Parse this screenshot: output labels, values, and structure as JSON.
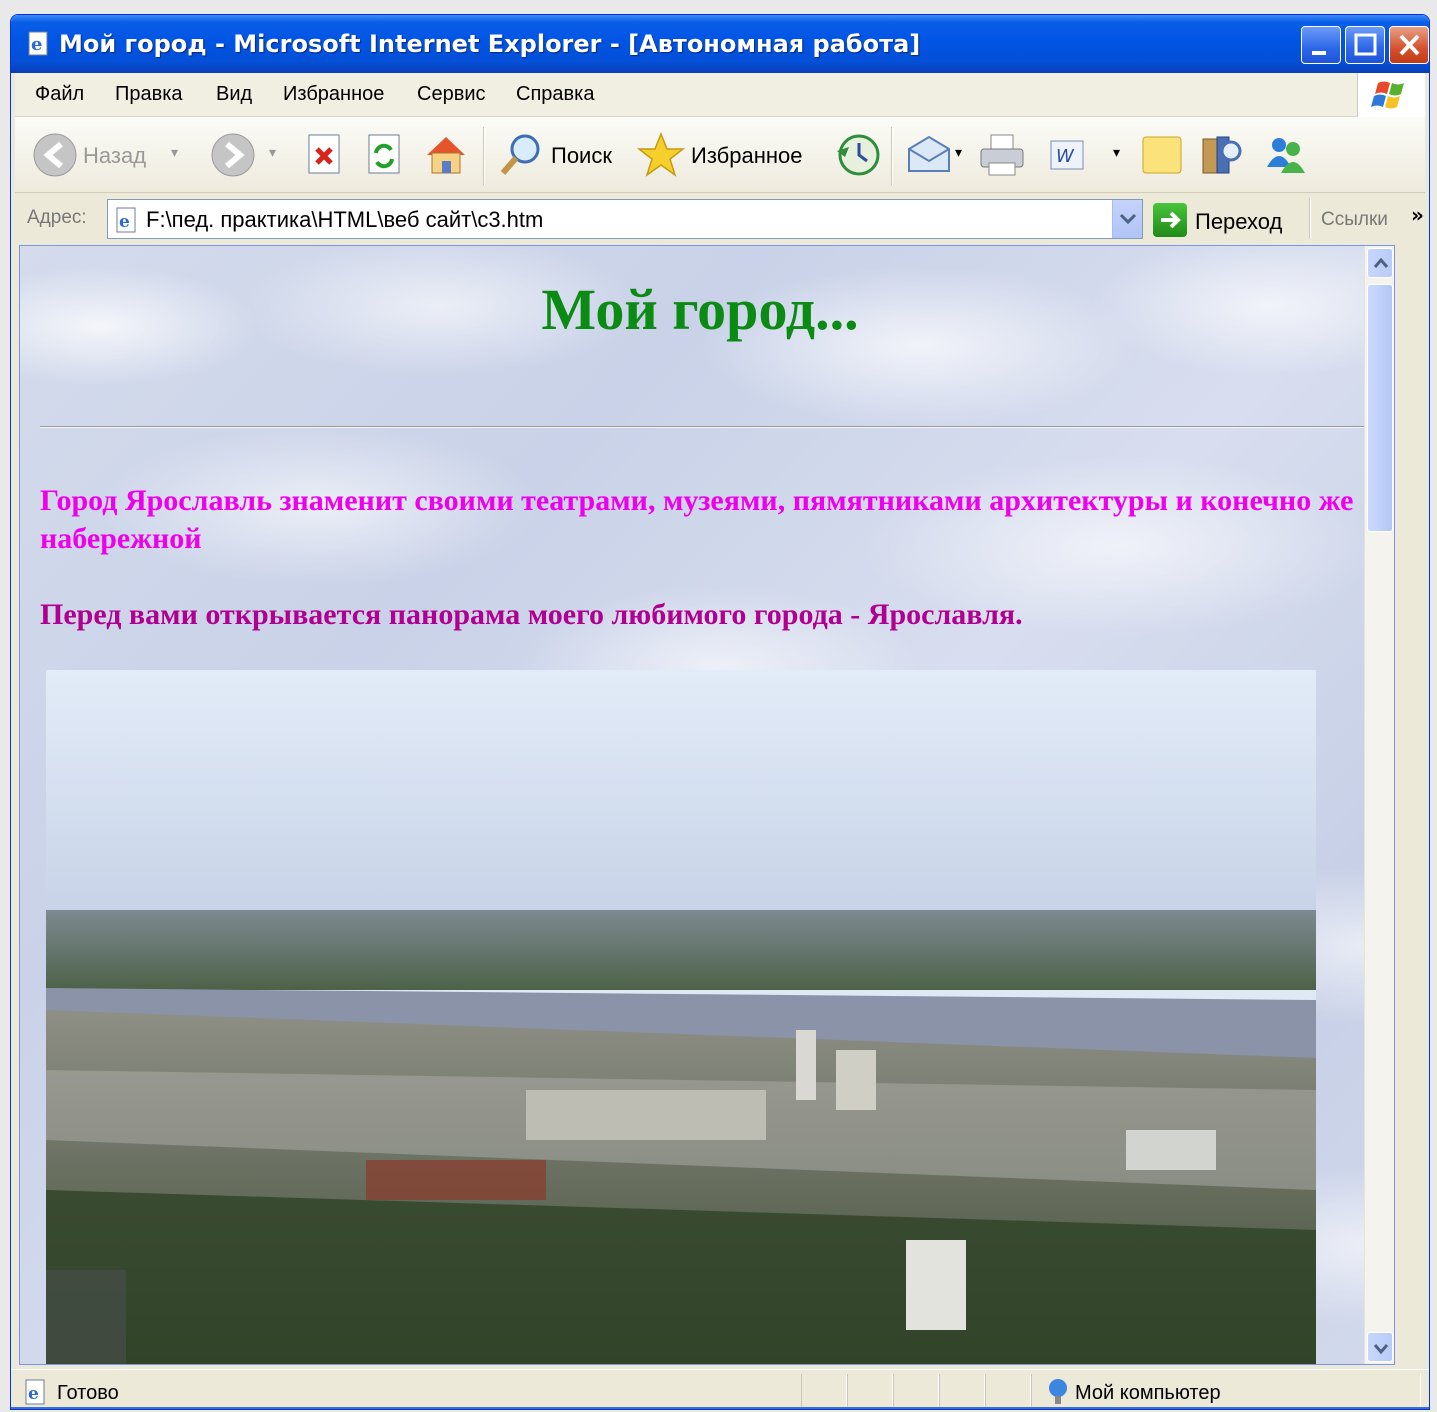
{
  "window": {
    "title": "Мой город - Microsoft Internet Explorer - [Автономная работа]"
  },
  "menu": {
    "items": [
      "Файл",
      "Правка",
      "Вид",
      "Избранное",
      "Сервис",
      "Справка"
    ]
  },
  "toolbar": {
    "back_label": "Назад",
    "search_label": "Поиск",
    "favorites_label": "Избранное"
  },
  "address": {
    "label": "Адрес:",
    "url": "F:\\пед. практика\\HTML\\веб сайт\\c3.htm",
    "go_label": "Переход",
    "links_label": "Ссылки",
    "links_chevron": "»"
  },
  "page": {
    "heading": "Мой город...",
    "paragraph1": "Город Ярославль знаменит своими театрами, музеями, пямятниками архитектуры и конечно же набережной",
    "paragraph2": "Перед вами открывается панорама моего любимого города - Ярославля.",
    "heading_color": "#0b8a14",
    "paragraph1_color": "#ee00ee",
    "paragraph2_color": "#b00090"
  },
  "status": {
    "text": "Готово",
    "zone": "Мой компьютер"
  },
  "icons": [
    "ie-page-icon",
    "back-arrow-icon",
    "forward-arrow-icon",
    "stop-icon",
    "refresh-icon",
    "home-icon",
    "search-magnifier-icon",
    "favorites-star-icon",
    "history-icon",
    "mail-icon",
    "print-icon",
    "word-edit-icon",
    "notes-icon",
    "research-icon",
    "messenger-icon",
    "windows-logo-icon",
    "go-arrow-icon",
    "computer-zone-icon"
  ]
}
